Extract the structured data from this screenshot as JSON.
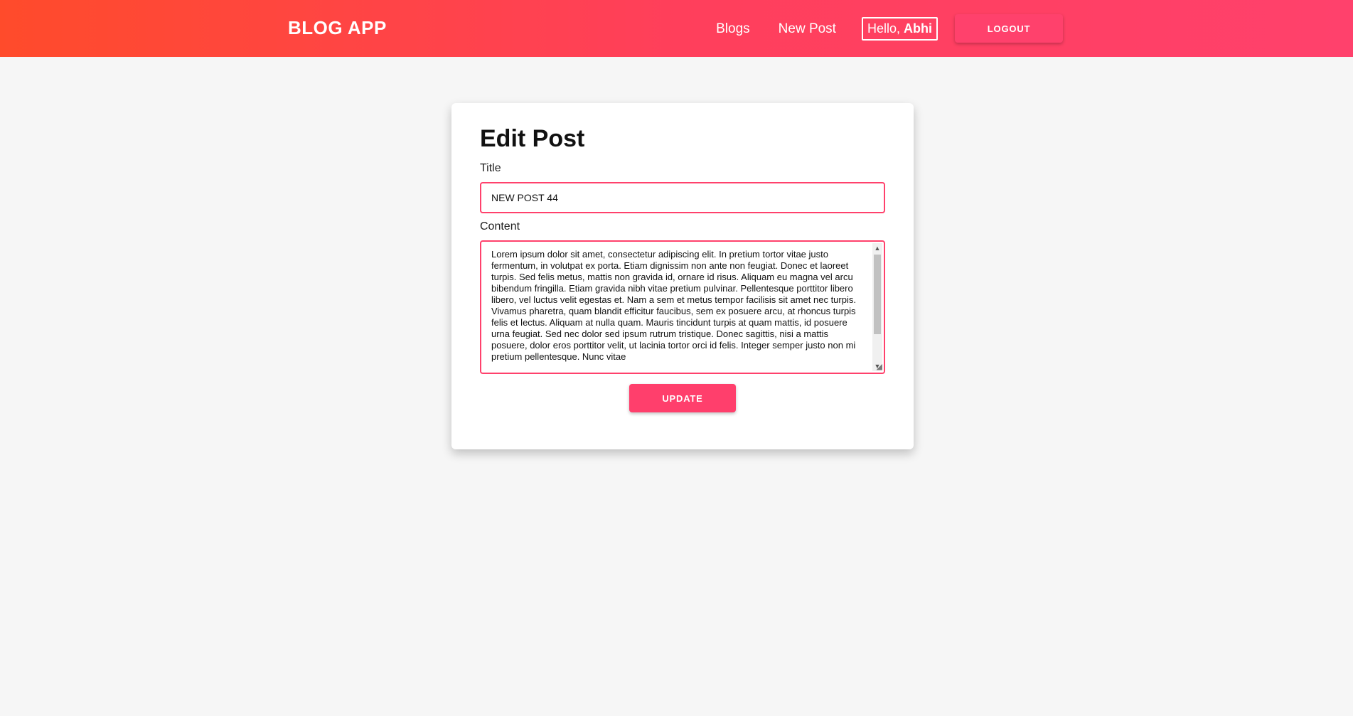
{
  "header": {
    "brand": "BLOG APP",
    "nav": {
      "blogs": "Blogs",
      "new_post": "New Post"
    },
    "greeting": {
      "prefix": "Hello,",
      "name": "Abhi"
    },
    "logout_label": "LOGOUT"
  },
  "editor": {
    "heading": "Edit Post",
    "title_label": "Title",
    "title_value": "NEW POST 44",
    "content_label": "Content",
    "content_value": "Lorem ipsum dolor sit amet, consectetur adipiscing elit. In pretium tortor vitae justo fermentum, in volutpat ex porta. Etiam dignissim non ante non feugiat. Donec et laoreet turpis. Sed felis metus, mattis non gravida id, ornare id risus. Aliquam eu magna vel arcu bibendum fringilla. Etiam gravida nibh vitae pretium pulvinar. Pellentesque porttitor libero libero, vel luctus velit egestas et. Nam a sem et metus tempor facilisis sit amet nec turpis. Vivamus pharetra, quam blandit efficitur faucibus, sem ex posuere arcu, at rhoncus turpis felis et lectus. Aliquam at nulla quam. Mauris tincidunt turpis at quam mattis, id posuere urna feugiat. Sed nec dolor sed ipsum rutrum tristique. Donec sagittis, nisi a mattis posuere, dolor eros porttitor velit, ut lacinia tortor orci id felis. Integer semper justo non mi pretium pellentesque. Nunc vitae",
    "update_label": "UPDATE"
  },
  "colors": {
    "header_gradient_start": "#ff4b2b",
    "header_gradient_end": "#ff416c",
    "accent": "#ff416c",
    "page_background": "#f6f6f6",
    "card_background": "#ffffff"
  },
  "icons": {
    "scroll_up": "scroll-up-arrow-icon",
    "scroll_down": "scroll-down-arrow-icon",
    "resize": "resize-grip-icon"
  }
}
